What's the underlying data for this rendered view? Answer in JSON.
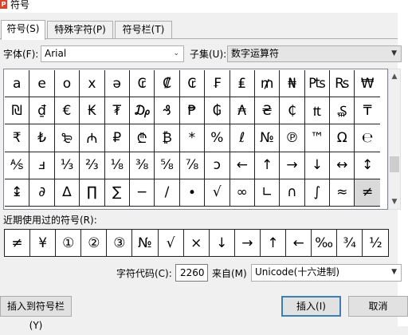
{
  "window": {
    "title": "符号",
    "app_icon": "wps-icon"
  },
  "tabs": [
    {
      "label": "符号(S)",
      "active": true
    },
    {
      "label": "特殊字符(P)",
      "active": false
    },
    {
      "label": "符号栏(T)",
      "active": false
    }
  ],
  "font": {
    "label": "字体(F):",
    "value": "Arial"
  },
  "subset": {
    "label": "子集(U):",
    "value": "数字运算符"
  },
  "grid": [
    "a",
    "e",
    "o",
    "x",
    "ə",
    "₢",
    "₡",
    "₢",
    "₣",
    "₤",
    "₥",
    "₦",
    "₧",
    "₨",
    "₩",
    "₪",
    "₫",
    "€",
    "₭",
    "₮",
    "₯",
    "₰",
    "₱",
    "₲",
    "₳",
    "₴",
    "₵",
    "₶",
    "₷",
    "₸",
    "₹",
    "₺",
    "₻",
    "₼",
    "₽",
    "₾",
    "₿",
    "*",
    "%",
    "ℓ",
    "№",
    "℗",
    "™",
    "Ω",
    "℮",
    "⅍",
    "ⅎ",
    "⅓",
    "⅔",
    "⅛",
    "⅜",
    "⅝",
    "⅞",
    "ↄ",
    "←",
    "↑",
    "→",
    "↓",
    "↔",
    "↕",
    "↨",
    "∂",
    "∆",
    "∏",
    "∑",
    "−",
    "∕",
    "∙",
    "√",
    "∞",
    "∟",
    "∩",
    "∫",
    "≈",
    "≠"
  ],
  "selected_symbol": "≠",
  "recent": {
    "label": "近期使用过的符号(R):",
    "symbols": [
      "≠",
      "¥",
      "①",
      "②",
      "③",
      "№",
      "√",
      "×",
      "↓",
      "→",
      "↑",
      "←",
      "‰",
      "¾",
      "½"
    ]
  },
  "char_code": {
    "label": "字符代码(C):",
    "value": "2260"
  },
  "from": {
    "label": "来自(M)",
    "value": "Unicode(十六进制)"
  },
  "buttons": {
    "insert_to_bar": "插入到符号栏(Y)",
    "insert": "插入(I)",
    "cancel": "取消"
  }
}
